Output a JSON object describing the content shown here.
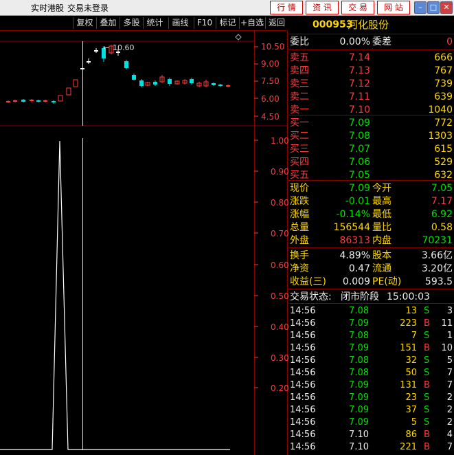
{
  "titlebar": {
    "left_text": "实时港股",
    "login_text": "交易未登录",
    "buttons": [
      "行 情",
      "资 讯",
      "交 易",
      "网 站"
    ],
    "win_buttons": [
      "minimize-icon",
      "maximize-icon",
      "close-icon"
    ]
  },
  "toolbar": {
    "items": [
      "复权",
      "叠加",
      "多股",
      "统计",
      "画线",
      "F10",
      "标记",
      "+自选",
      "返回"
    ]
  },
  "chart": {
    "high_label": "10.60",
    "price_axis": [
      "10.50",
      "9.00",
      "7.50",
      "6.00",
      "4.50"
    ],
    "ratio_axis": [
      "1.00",
      "0.90",
      "0.80",
      "0.70",
      "0.60",
      "0.50",
      "0.40",
      "0.30",
      "0.20"
    ]
  },
  "stock": {
    "code": "000953",
    "name": "河化股份",
    "weibi_label": "委比",
    "weibi": "0.00%",
    "weicha_label": "委差",
    "weicha": "0"
  },
  "sell": [
    {
      "label": "卖五",
      "price": "7.14",
      "vol": "666"
    },
    {
      "label": "卖四",
      "price": "7.13",
      "vol": "767"
    },
    {
      "label": "卖三",
      "price": "7.12",
      "vol": "739"
    },
    {
      "label": "卖二",
      "price": "7.11",
      "vol": "639"
    },
    {
      "label": "卖一",
      "price": "7.10",
      "vol": "1040"
    }
  ],
  "buy": [
    {
      "label": "买一",
      "price": "7.09",
      "vol": "772"
    },
    {
      "label": "买二",
      "price": "7.08",
      "vol": "1303"
    },
    {
      "label": "买三",
      "price": "7.07",
      "vol": "615"
    },
    {
      "label": "买四",
      "price": "7.06",
      "vol": "529"
    },
    {
      "label": "买五",
      "price": "7.05",
      "vol": "632"
    }
  ],
  "quote": [
    {
      "l1": "现价",
      "v1": "7.09",
      "c1": "green",
      "l2": "今开",
      "v2": "7.05",
      "c2": "green"
    },
    {
      "l1": "涨跌",
      "v1": "-0.01",
      "c1": "green",
      "l2": "最高",
      "v2": "7.17",
      "c2": "red"
    },
    {
      "l1": "涨幅",
      "v1": "-0.14%",
      "c1": "green",
      "l2": "最低",
      "v2": "6.92",
      "c2": "green"
    },
    {
      "l1": "总量",
      "v1": "156544",
      "c1": "yel",
      "l2": "量比",
      "v2": "0.58",
      "c2": "yel"
    },
    {
      "l1": "外盘",
      "v1": "86313",
      "c1": "red",
      "l2": "内盘",
      "v2": "70231",
      "c2": "green"
    }
  ],
  "finance": [
    {
      "l1": "换手",
      "v1": "4.89%",
      "l2": "股本",
      "v2": "3.66亿"
    },
    {
      "l1": "净资",
      "v1": "0.47",
      "l2": "流通",
      "v2": "3.20亿"
    },
    {
      "l1": "收益(三)",
      "v1": "0.009",
      "l2": "PE(动)",
      "v2": "593.5"
    }
  ],
  "status": {
    "label": "交易状态:",
    "value": "闭市阶段",
    "time": "15:00:03"
  },
  "ticks": [
    {
      "time": "14:56",
      "price": "7.08",
      "pc": "green",
      "vol": "13",
      "side": "S",
      "n": "3"
    },
    {
      "time": "14:56",
      "price": "7.09",
      "pc": "green",
      "vol": "223",
      "side": "B",
      "n": "11"
    },
    {
      "time": "14:56",
      "price": "7.08",
      "pc": "green",
      "vol": "7",
      "side": "S",
      "n": "1"
    },
    {
      "time": "14:56",
      "price": "7.09",
      "pc": "green",
      "vol": "151",
      "side": "B",
      "n": "10"
    },
    {
      "time": "14:56",
      "price": "7.08",
      "pc": "green",
      "vol": "32",
      "side": "S",
      "n": "5"
    },
    {
      "time": "14:56",
      "price": "7.08",
      "pc": "green",
      "vol": "50",
      "side": "S",
      "n": "7"
    },
    {
      "time": "14:56",
      "price": "7.09",
      "pc": "green",
      "vol": "131",
      "side": "B",
      "n": "7"
    },
    {
      "time": "14:56",
      "price": "7.09",
      "pc": "green",
      "vol": "23",
      "side": "S",
      "n": "2"
    },
    {
      "time": "14:56",
      "price": "7.09",
      "pc": "green",
      "vol": "37",
      "side": "S",
      "n": "2"
    },
    {
      "time": "14:56",
      "price": "7.09",
      "pc": "green",
      "vol": "5",
      "side": "S",
      "n": "2"
    },
    {
      "time": "14:56",
      "price": "7.10",
      "pc": "white",
      "vol": "86",
      "side": "B",
      "n": "4"
    },
    {
      "time": "14:56",
      "price": "7.10",
      "pc": "white",
      "vol": "221",
      "side": "B",
      "n": "7"
    }
  ]
}
